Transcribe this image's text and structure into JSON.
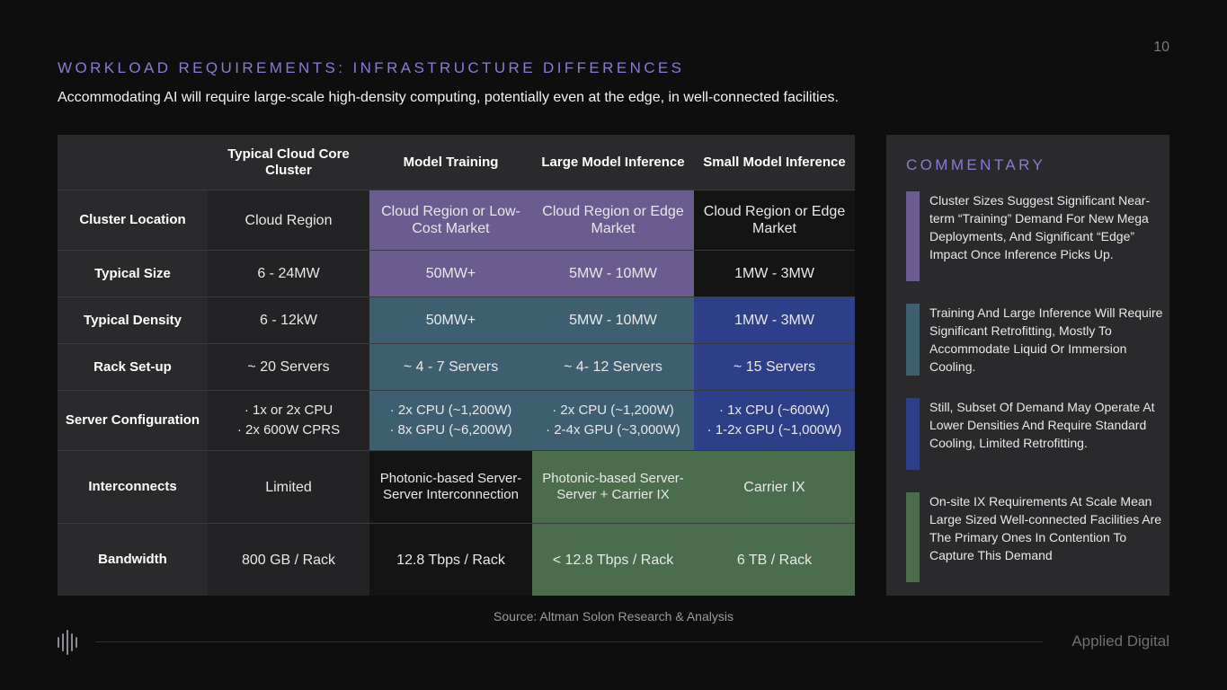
{
  "page_number": "10",
  "title": "WORKLOAD REQUIREMENTS: INFRASTRUCTURE DIFFERENCES",
  "subtitle": "Accommodating AI will require large-scale high-density computing, potentially even at the edge, in well-connected facilities.",
  "table": {
    "columns": [
      "Typical Cloud Core Cluster",
      "Model Training",
      "Large Model Inference",
      "Small Model Inference"
    ],
    "rows": [
      {
        "label": "Cluster Location",
        "cells": [
          "Cloud Region",
          "Cloud Region or Low-Cost Market",
          "Cloud Region or Edge Market",
          "Cloud Region or Edge Market"
        ]
      },
      {
        "label": "Typical Size",
        "cells": [
          "6 - 24MW",
          "50MW+",
          "5MW - 10MW",
          "1MW - 3MW"
        ]
      },
      {
        "label": "Typical Density",
        "cells": [
          "6 - 12kW",
          "50MW+",
          "5MW - 10MW",
          "1MW - 3MW"
        ]
      },
      {
        "label": "Rack Set-up",
        "cells": [
          "~ 20 Servers",
          "~ 4 - 7 Servers",
          "~ 4- 12 Servers",
          "~ 15 Servers"
        ]
      },
      {
        "label": "Server Configuration",
        "cells": [
          [
            "· 1x or 2x CPU",
            "· 2x 600W CPRS"
          ],
          [
            "· 2x CPU (~1,200W)",
            "· 8x GPU (~6,200W)"
          ],
          [
            "· 2x CPU (~1,200W)",
            "· 2-4x GPU (~3,000W)"
          ],
          [
            "· 1x CPU (~600W)",
            "· 1-2x GPU (~1,000W)"
          ]
        ]
      },
      {
        "label": "Interconnects",
        "cells": [
          "Limited",
          "Photonic-based Server-Server Interconnection",
          "Photonic-based Server-Server + Carrier IX",
          "Carrier IX"
        ]
      },
      {
        "label": "Bandwidth",
        "cells": [
          "800 GB / Rack",
          "12.8 Tbps / Rack",
          "< 12.8 Tbps / Rack",
          "6 TB / Rack"
        ]
      }
    ]
  },
  "commentary": {
    "title": "COMMENTARY",
    "items": [
      {
        "text": "Cluster Sizes Suggest Significant Near-term “Training” Demand For New Mega Deployments, And Significant “Edge” Impact Once Inference Picks Up.",
        "color": "#6a5c8f"
      },
      {
        "text": "Training And Large Inference Will Require Significant Retrofitting, Mostly To Accommodate Liquid Or Immersion Cooling.",
        "color": "#3e5f70"
      },
      {
        "text": "Still, Subset Of Demand May Operate At Lower Densities And Require Standard Cooling, Limited Retrofitting.",
        "color": "#2e3f8a"
      },
      {
        "text": "On-site IX Requirements At Scale Mean Large Sized Well-connected Facilities Are The Primary Ones In Contention To Capture This Demand",
        "color": "#4c6d4c"
      }
    ]
  },
  "source": "Source: Altman Solon Research & Analysis",
  "brand": "Applied Digital",
  "colors": {
    "accent": "#8c7ad6",
    "purple": "#6a5c8f",
    "teal": "#3e5f70",
    "blue": "#2e3f8a",
    "green": "#4c6d4c"
  }
}
